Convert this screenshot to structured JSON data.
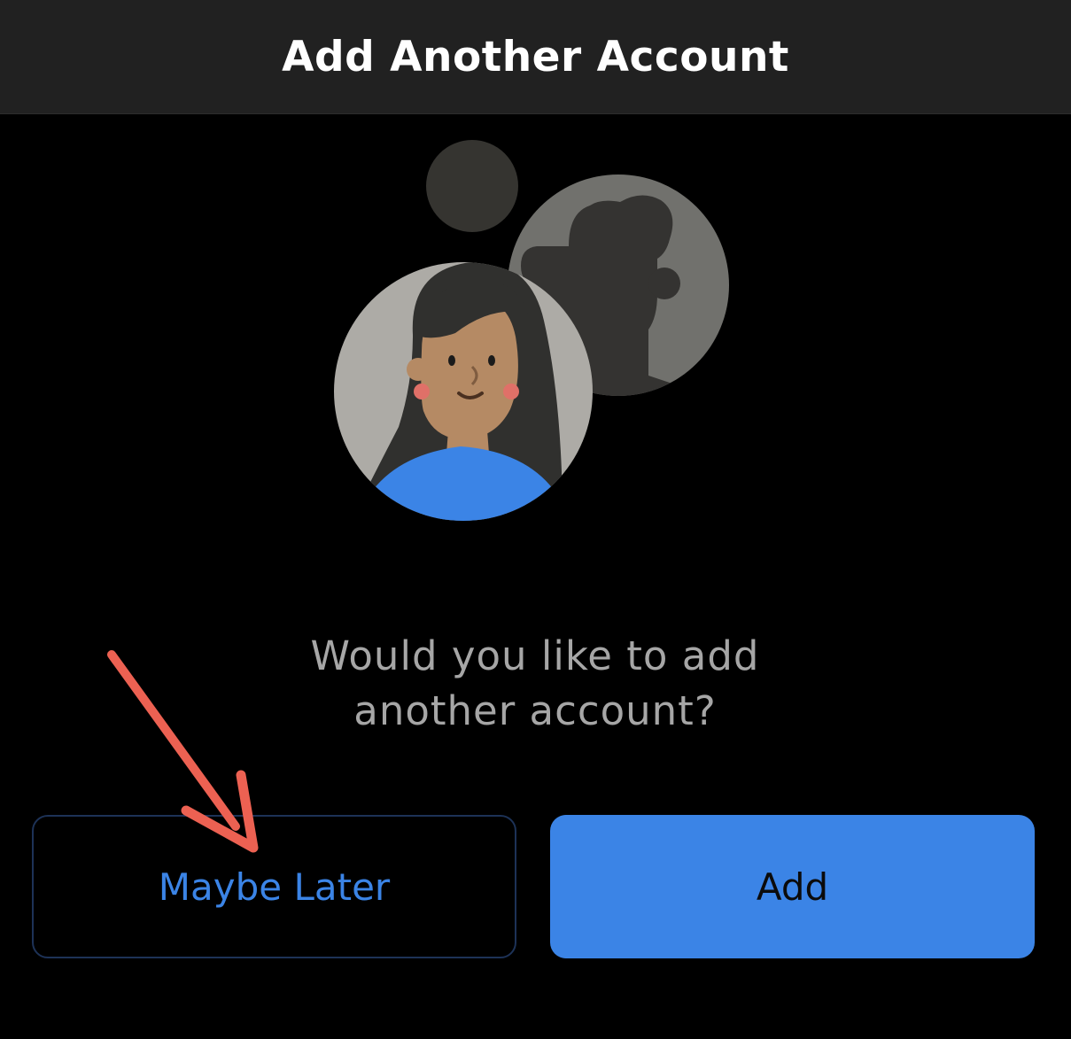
{
  "header": {
    "title": "Add Another Account"
  },
  "illustration": {
    "icon": "add-account-avatars-illustration"
  },
  "prompt": {
    "text": "Would you like to add\nanother account?"
  },
  "actions": {
    "maybe_later_label": "Maybe Later",
    "add_label": "Add"
  },
  "annotation": {
    "icon": "red-arrow-pointer",
    "color": "#ec6152"
  },
  "colors": {
    "accent": "#3b84e6",
    "header_bg": "#212121",
    "background": "#000000"
  }
}
